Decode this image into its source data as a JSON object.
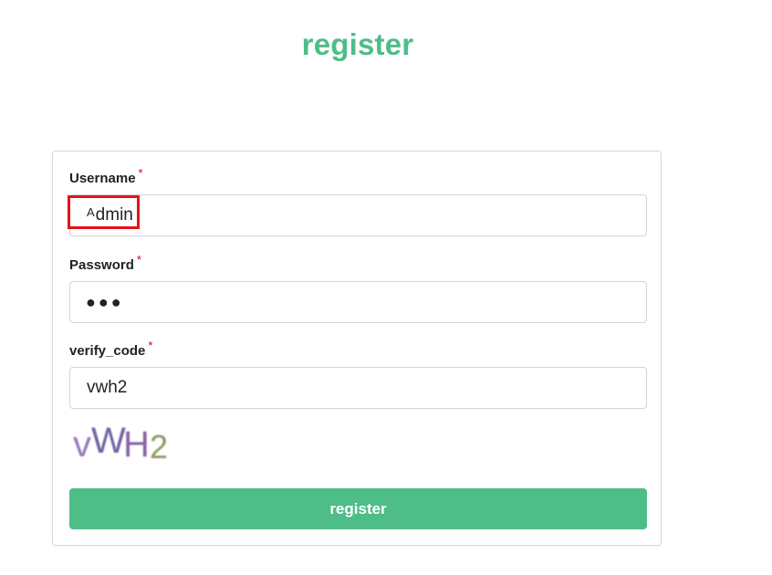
{
  "page": {
    "title": "register"
  },
  "form": {
    "username": {
      "label": "Username",
      "required_mark": "*",
      "value_prefix": "A",
      "value_rest": "dmin"
    },
    "password": {
      "label": "Password",
      "required_mark": "*",
      "masked_value": "●●●"
    },
    "verify_code": {
      "label": "verify_code",
      "required_mark": "*",
      "value": "vwh2"
    },
    "captcha": {
      "text": "vWH2"
    },
    "submit_label": "register"
  },
  "colors": {
    "accent": "#4ebd88",
    "required": "#d9001b",
    "highlight": "#e5131b"
  }
}
